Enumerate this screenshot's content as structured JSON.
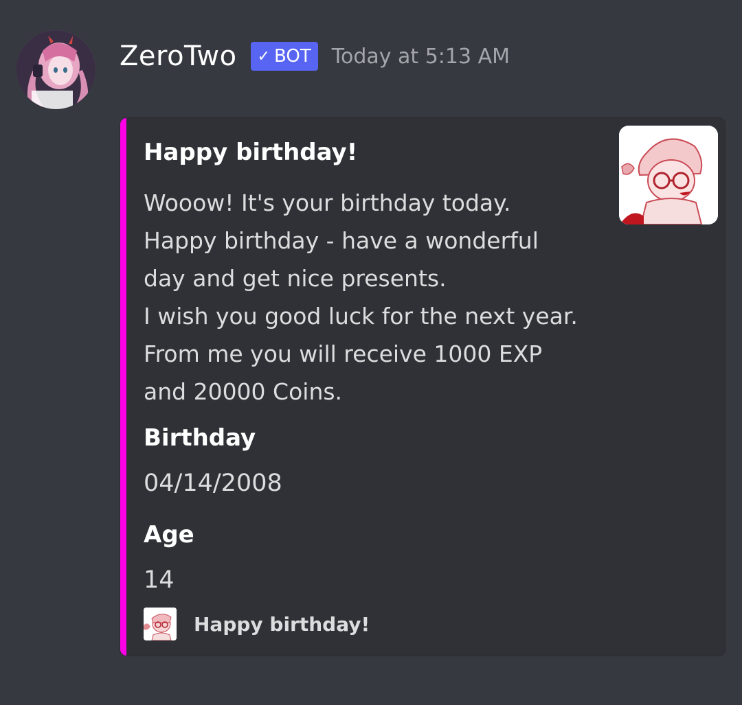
{
  "message": {
    "author": {
      "name": "ZeroTwo",
      "avatar_icon": "anime-avatar"
    },
    "bot_tag": {
      "check": "✓",
      "label": "BOT",
      "color": "#5865f2"
    },
    "timestamp": "Today at 5:13 AM"
  },
  "embed": {
    "accent_color": "#ff00e6",
    "title": "Happy birthday!",
    "description_lines": [
      "Wooow! It's your birthday today.",
      "Happy birthday - have a wonderful",
      "day and get nice presents.",
      "I wish you good luck for the next year.",
      "From me you will receive 1000 EXP",
      "and 20000 Coins."
    ],
    "fields": [
      {
        "name": "Birthday",
        "value": "04/14/2008"
      },
      {
        "name": "Age",
        "value": "14"
      }
    ],
    "thumbnail_icon": "anime-sketch-thumbnail",
    "footer": {
      "icon": "anime-sketch-icon",
      "text": "Happy birthday!"
    }
  }
}
